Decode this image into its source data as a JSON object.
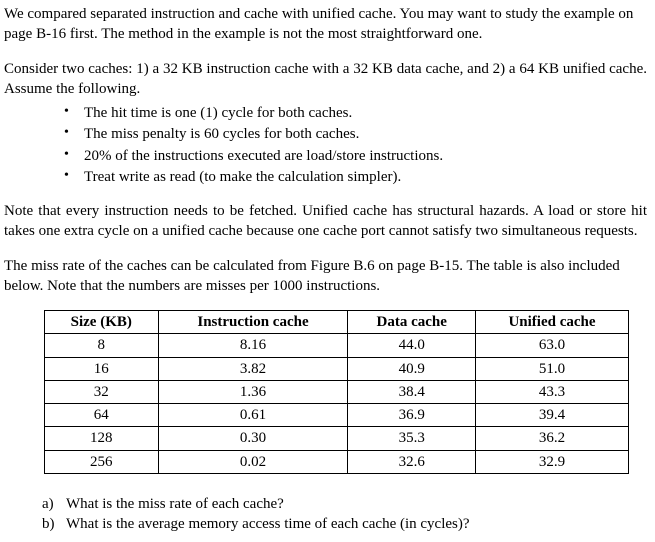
{
  "para1": "We compared separated instruction and cache with unified cache. You may want to study the example on page B-16 first. The method in the example is not the most straightforward one.",
  "para2": "Consider two caches: 1) a 32 KB instruction cache with a 32 KB data cache, and 2) a 64 KB unified cache. Assume the following.",
  "bullets": [
    "The hit time is one (1) cycle for both caches.",
    "The miss penalty is 60 cycles for both caches.",
    "20% of the instructions executed are load/store instructions.",
    "Treat write as read (to make the calculation simpler)."
  ],
  "para3": "Note that every instruction needs to be fetched. Unified cache has structural hazards. A load or store hit takes one extra cycle on a unified cache because one cache port cannot satisfy two simultaneous requests.",
  "para4": "The miss rate of the caches can be calculated from Figure B.6 on page B-15. The table is also included below. Note that the numbers are misses per 1000 instructions.",
  "table": {
    "headers": [
      "Size (KB)",
      "Instruction cache",
      "Data cache",
      "Unified cache"
    ],
    "rows": [
      [
        "8",
        "8.16",
        "44.0",
        "63.0"
      ],
      [
        "16",
        "3.82",
        "40.9",
        "51.0"
      ],
      [
        "32",
        "1.36",
        "38.4",
        "43.3"
      ],
      [
        "64",
        "0.61",
        "36.9",
        "39.4"
      ],
      [
        "128",
        "0.30",
        "35.3",
        "36.2"
      ],
      [
        "256",
        "0.02",
        "32.6",
        "32.9"
      ]
    ]
  },
  "questions": [
    {
      "marker": "a)",
      "text": "What is the miss rate of each cache?"
    },
    {
      "marker": "b)",
      "text": "What is the average memory access time of each cache (in cycles)?"
    }
  ],
  "chart_data": {
    "type": "table",
    "title": "Misses per 1000 instructions by cache size",
    "columns": [
      "Size (KB)",
      "Instruction cache",
      "Data cache",
      "Unified cache"
    ],
    "rows": [
      {
        "Size (KB)": 8,
        "Instruction cache": 8.16,
        "Data cache": 44.0,
        "Unified cache": 63.0
      },
      {
        "Size (KB)": 16,
        "Instruction cache": 3.82,
        "Data cache": 40.9,
        "Unified cache": 51.0
      },
      {
        "Size (KB)": 32,
        "Instruction cache": 1.36,
        "Data cache": 38.4,
        "Unified cache": 43.3
      },
      {
        "Size (KB)": 64,
        "Instruction cache": 0.61,
        "Data cache": 36.9,
        "Unified cache": 39.4
      },
      {
        "Size (KB)": 128,
        "Instruction cache": 0.3,
        "Data cache": 35.3,
        "Unified cache": 36.2
      },
      {
        "Size (KB)": 256,
        "Instruction cache": 0.02,
        "Data cache": 32.6,
        "Unified cache": 32.9
      }
    ]
  }
}
